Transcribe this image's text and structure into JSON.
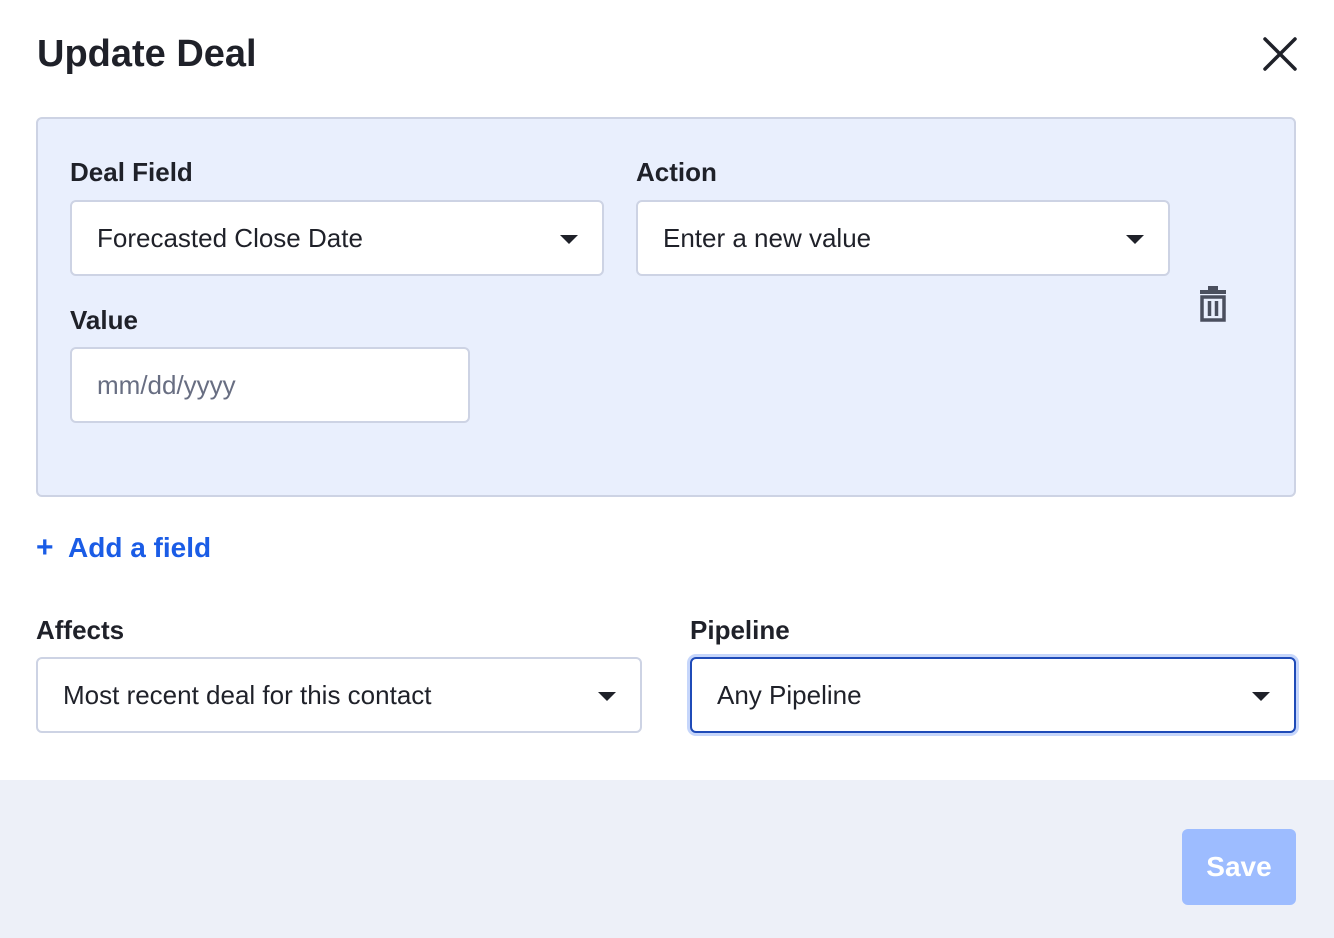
{
  "dialog": {
    "title": "Update Deal",
    "close_icon": "close-icon"
  },
  "field_card": {
    "deal_field_label": "Deal Field",
    "deal_field_value": "Forecasted Close Date",
    "action_label": "Action",
    "action_value": "Enter a new value",
    "value_label": "Value",
    "value_placeholder": "mm/dd/yyyy",
    "delete_icon": "trash-icon"
  },
  "add_field": {
    "icon": "plus-icon",
    "label": "Add a field"
  },
  "affects": {
    "label": "Affects",
    "value": "Most recent deal for this contact"
  },
  "pipeline": {
    "label": "Pipeline",
    "value": "Any Pipeline"
  },
  "footer": {
    "save_label": "Save"
  },
  "colors": {
    "accent": "#1a5ce6",
    "card_bg": "#e9effd",
    "footer_bg": "#edf0f8",
    "save_disabled": "#9dbcff",
    "focus_border": "#1f4bb8"
  }
}
